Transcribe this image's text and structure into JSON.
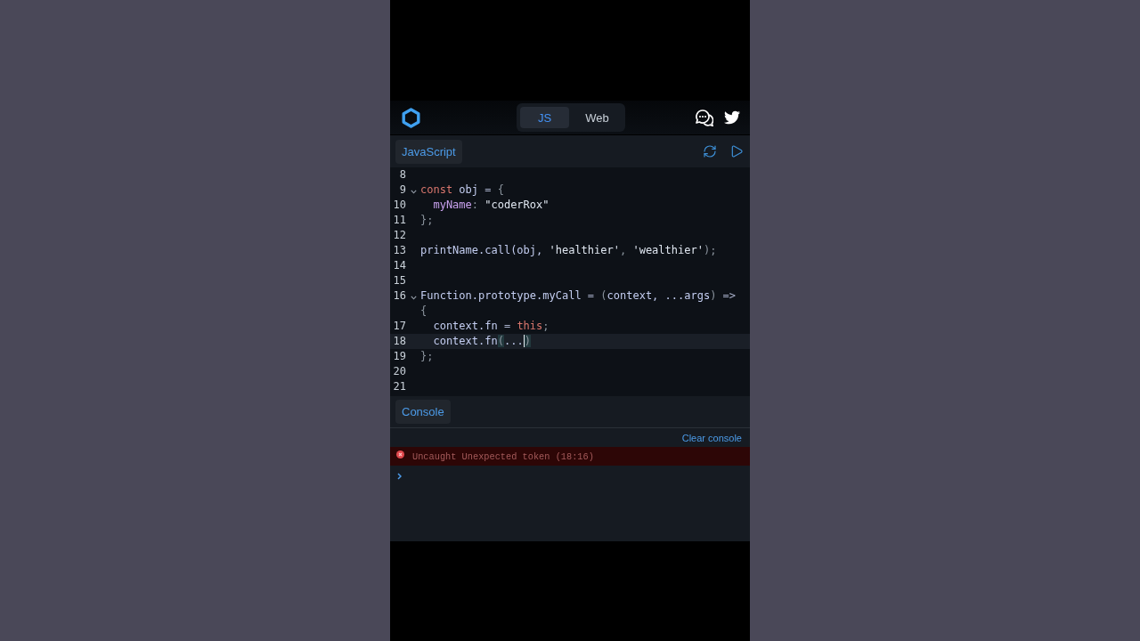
{
  "header": {
    "tabs": [
      {
        "label": "JS",
        "selected": true
      },
      {
        "label": "Web",
        "selected": false
      }
    ]
  },
  "editor": {
    "tab": {
      "label": "JavaScript"
    },
    "lines": [
      {
        "number": "8",
        "foldable": false,
        "active": false
      },
      {
        "number": "9",
        "foldable": true,
        "active": false,
        "tokens": [
          {
            "text": "const",
            "kind": "keyword"
          },
          {
            "text": " obj ",
            "kind": "variable"
          },
          {
            "text": "=",
            "kind": "operator"
          },
          {
            "text": " {",
            "kind": "punct"
          }
        ]
      },
      {
        "number": "10",
        "foldable": false,
        "active": false,
        "tokens": [
          {
            "text": "  myName",
            "kind": "property"
          },
          {
            "text": ": ",
            "kind": "punct"
          },
          {
            "text": "\"coderRox\"",
            "kind": "string"
          }
        ]
      },
      {
        "number": "11",
        "foldable": false,
        "active": false,
        "tokens": [
          {
            "text": "};",
            "kind": "punct"
          }
        ]
      },
      {
        "number": "12",
        "foldable": false,
        "active": false
      },
      {
        "number": "13",
        "foldable": false,
        "active": false,
        "tokens": [
          {
            "text": "printName.call(obj, ",
            "kind": "variable"
          },
          {
            "text": "'healthier'",
            "kind": "string"
          },
          {
            "text": ", ",
            "kind": "punct"
          },
          {
            "text": "'wealthier'",
            "kind": "string"
          },
          {
            "text": ");",
            "kind": "punct"
          }
        ]
      },
      {
        "number": "14",
        "foldable": false,
        "active": false
      },
      {
        "number": "15",
        "foldable": false,
        "active": false
      },
      {
        "number": "16",
        "foldable": true,
        "active": false,
        "tokens": [
          {
            "text": "Function.prototype.myCall",
            "kind": "variable"
          },
          {
            "text": " = ",
            "kind": "operator"
          },
          {
            "text": "(",
            "kind": "punct"
          },
          {
            "text": "context, ...args",
            "kind": "variable"
          },
          {
            "text": ")",
            "kind": "punct"
          },
          {
            "text": " =>",
            "kind": "operator"
          }
        ],
        "continuation": [
          {
            "text": "{",
            "kind": "punct"
          }
        ]
      },
      {
        "number": "17",
        "foldable": false,
        "active": false,
        "tokens": [
          {
            "text": "  context.fn",
            "kind": "variable"
          },
          {
            "text": " = ",
            "kind": "operator"
          },
          {
            "text": "this",
            "kind": "keyword"
          },
          {
            "text": ";",
            "kind": "punct"
          }
        ]
      },
      {
        "number": "18",
        "foldable": false,
        "active": true,
        "tokens": [
          {
            "text": "  context.fn",
            "kind": "variable"
          },
          {
            "text": "(",
            "kind": "bracket-match"
          },
          {
            "text": "...",
            "kind": "variable"
          },
          {
            "kind": "cursor"
          },
          {
            "text": ")",
            "kind": "bracket-match"
          }
        ]
      },
      {
        "number": "19",
        "foldable": false,
        "active": false,
        "tokens": [
          {
            "text": "};",
            "kind": "punct"
          }
        ]
      },
      {
        "number": "20",
        "foldable": false,
        "active": false
      },
      {
        "number": "21",
        "foldable": false,
        "active": false
      }
    ]
  },
  "console": {
    "tab": {
      "label": "Console"
    },
    "clear_label": "Clear console",
    "messages": [
      {
        "kind": "error",
        "text": "Uncaught Unexpected token (18:16)"
      }
    ]
  }
}
